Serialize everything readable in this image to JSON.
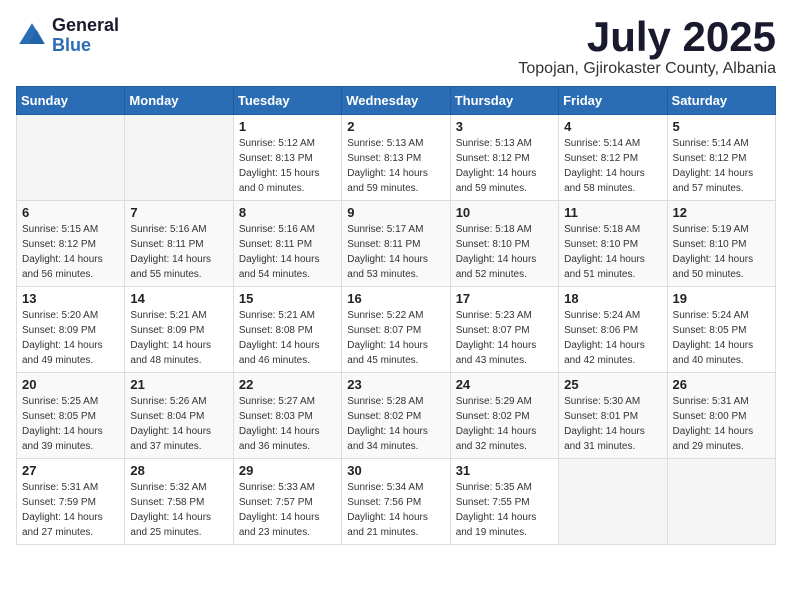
{
  "logo": {
    "general": "General",
    "blue": "Blue"
  },
  "title": {
    "month_year": "July 2025",
    "location": "Topojan, Gjirokaster County, Albania"
  },
  "headers": [
    "Sunday",
    "Monday",
    "Tuesday",
    "Wednesday",
    "Thursday",
    "Friday",
    "Saturday"
  ],
  "weeks": [
    [
      {
        "day": "",
        "sunrise": "",
        "sunset": "",
        "daylight": "",
        "empty": true
      },
      {
        "day": "",
        "sunrise": "",
        "sunset": "",
        "daylight": "",
        "empty": true
      },
      {
        "day": "1",
        "sunrise": "Sunrise: 5:12 AM",
        "sunset": "Sunset: 8:13 PM",
        "daylight": "Daylight: 15 hours and 0 minutes.",
        "empty": false
      },
      {
        "day": "2",
        "sunrise": "Sunrise: 5:13 AM",
        "sunset": "Sunset: 8:13 PM",
        "daylight": "Daylight: 14 hours and 59 minutes.",
        "empty": false
      },
      {
        "day": "3",
        "sunrise": "Sunrise: 5:13 AM",
        "sunset": "Sunset: 8:12 PM",
        "daylight": "Daylight: 14 hours and 59 minutes.",
        "empty": false
      },
      {
        "day": "4",
        "sunrise": "Sunrise: 5:14 AM",
        "sunset": "Sunset: 8:12 PM",
        "daylight": "Daylight: 14 hours and 58 minutes.",
        "empty": false
      },
      {
        "day": "5",
        "sunrise": "Sunrise: 5:14 AM",
        "sunset": "Sunset: 8:12 PM",
        "daylight": "Daylight: 14 hours and 57 minutes.",
        "empty": false
      }
    ],
    [
      {
        "day": "6",
        "sunrise": "Sunrise: 5:15 AM",
        "sunset": "Sunset: 8:12 PM",
        "daylight": "Daylight: 14 hours and 56 minutes.",
        "empty": false
      },
      {
        "day": "7",
        "sunrise": "Sunrise: 5:16 AM",
        "sunset": "Sunset: 8:11 PM",
        "daylight": "Daylight: 14 hours and 55 minutes.",
        "empty": false
      },
      {
        "day": "8",
        "sunrise": "Sunrise: 5:16 AM",
        "sunset": "Sunset: 8:11 PM",
        "daylight": "Daylight: 14 hours and 54 minutes.",
        "empty": false
      },
      {
        "day": "9",
        "sunrise": "Sunrise: 5:17 AM",
        "sunset": "Sunset: 8:11 PM",
        "daylight": "Daylight: 14 hours and 53 minutes.",
        "empty": false
      },
      {
        "day": "10",
        "sunrise": "Sunrise: 5:18 AM",
        "sunset": "Sunset: 8:10 PM",
        "daylight": "Daylight: 14 hours and 52 minutes.",
        "empty": false
      },
      {
        "day": "11",
        "sunrise": "Sunrise: 5:18 AM",
        "sunset": "Sunset: 8:10 PM",
        "daylight": "Daylight: 14 hours and 51 minutes.",
        "empty": false
      },
      {
        "day": "12",
        "sunrise": "Sunrise: 5:19 AM",
        "sunset": "Sunset: 8:10 PM",
        "daylight": "Daylight: 14 hours and 50 minutes.",
        "empty": false
      }
    ],
    [
      {
        "day": "13",
        "sunrise": "Sunrise: 5:20 AM",
        "sunset": "Sunset: 8:09 PM",
        "daylight": "Daylight: 14 hours and 49 minutes.",
        "empty": false
      },
      {
        "day": "14",
        "sunrise": "Sunrise: 5:21 AM",
        "sunset": "Sunset: 8:09 PM",
        "daylight": "Daylight: 14 hours and 48 minutes.",
        "empty": false
      },
      {
        "day": "15",
        "sunrise": "Sunrise: 5:21 AM",
        "sunset": "Sunset: 8:08 PM",
        "daylight": "Daylight: 14 hours and 46 minutes.",
        "empty": false
      },
      {
        "day": "16",
        "sunrise": "Sunrise: 5:22 AM",
        "sunset": "Sunset: 8:07 PM",
        "daylight": "Daylight: 14 hours and 45 minutes.",
        "empty": false
      },
      {
        "day": "17",
        "sunrise": "Sunrise: 5:23 AM",
        "sunset": "Sunset: 8:07 PM",
        "daylight": "Daylight: 14 hours and 43 minutes.",
        "empty": false
      },
      {
        "day": "18",
        "sunrise": "Sunrise: 5:24 AM",
        "sunset": "Sunset: 8:06 PM",
        "daylight": "Daylight: 14 hours and 42 minutes.",
        "empty": false
      },
      {
        "day": "19",
        "sunrise": "Sunrise: 5:24 AM",
        "sunset": "Sunset: 8:05 PM",
        "daylight": "Daylight: 14 hours and 40 minutes.",
        "empty": false
      }
    ],
    [
      {
        "day": "20",
        "sunrise": "Sunrise: 5:25 AM",
        "sunset": "Sunset: 8:05 PM",
        "daylight": "Daylight: 14 hours and 39 minutes.",
        "empty": false
      },
      {
        "day": "21",
        "sunrise": "Sunrise: 5:26 AM",
        "sunset": "Sunset: 8:04 PM",
        "daylight": "Daylight: 14 hours and 37 minutes.",
        "empty": false
      },
      {
        "day": "22",
        "sunrise": "Sunrise: 5:27 AM",
        "sunset": "Sunset: 8:03 PM",
        "daylight": "Daylight: 14 hours and 36 minutes.",
        "empty": false
      },
      {
        "day": "23",
        "sunrise": "Sunrise: 5:28 AM",
        "sunset": "Sunset: 8:02 PM",
        "daylight": "Daylight: 14 hours and 34 minutes.",
        "empty": false
      },
      {
        "day": "24",
        "sunrise": "Sunrise: 5:29 AM",
        "sunset": "Sunset: 8:02 PM",
        "daylight": "Daylight: 14 hours and 32 minutes.",
        "empty": false
      },
      {
        "day": "25",
        "sunrise": "Sunrise: 5:30 AM",
        "sunset": "Sunset: 8:01 PM",
        "daylight": "Daylight: 14 hours and 31 minutes.",
        "empty": false
      },
      {
        "day": "26",
        "sunrise": "Sunrise: 5:31 AM",
        "sunset": "Sunset: 8:00 PM",
        "daylight": "Daylight: 14 hours and 29 minutes.",
        "empty": false
      }
    ],
    [
      {
        "day": "27",
        "sunrise": "Sunrise: 5:31 AM",
        "sunset": "Sunset: 7:59 PM",
        "daylight": "Daylight: 14 hours and 27 minutes.",
        "empty": false
      },
      {
        "day": "28",
        "sunrise": "Sunrise: 5:32 AM",
        "sunset": "Sunset: 7:58 PM",
        "daylight": "Daylight: 14 hours and 25 minutes.",
        "empty": false
      },
      {
        "day": "29",
        "sunrise": "Sunrise: 5:33 AM",
        "sunset": "Sunset: 7:57 PM",
        "daylight": "Daylight: 14 hours and 23 minutes.",
        "empty": false
      },
      {
        "day": "30",
        "sunrise": "Sunrise: 5:34 AM",
        "sunset": "Sunset: 7:56 PM",
        "daylight": "Daylight: 14 hours and 21 minutes.",
        "empty": false
      },
      {
        "day": "31",
        "sunrise": "Sunrise: 5:35 AM",
        "sunset": "Sunset: 7:55 PM",
        "daylight": "Daylight: 14 hours and 19 minutes.",
        "empty": false
      },
      {
        "day": "",
        "sunrise": "",
        "sunset": "",
        "daylight": "",
        "empty": true
      },
      {
        "day": "",
        "sunrise": "",
        "sunset": "",
        "daylight": "",
        "empty": true
      }
    ]
  ]
}
